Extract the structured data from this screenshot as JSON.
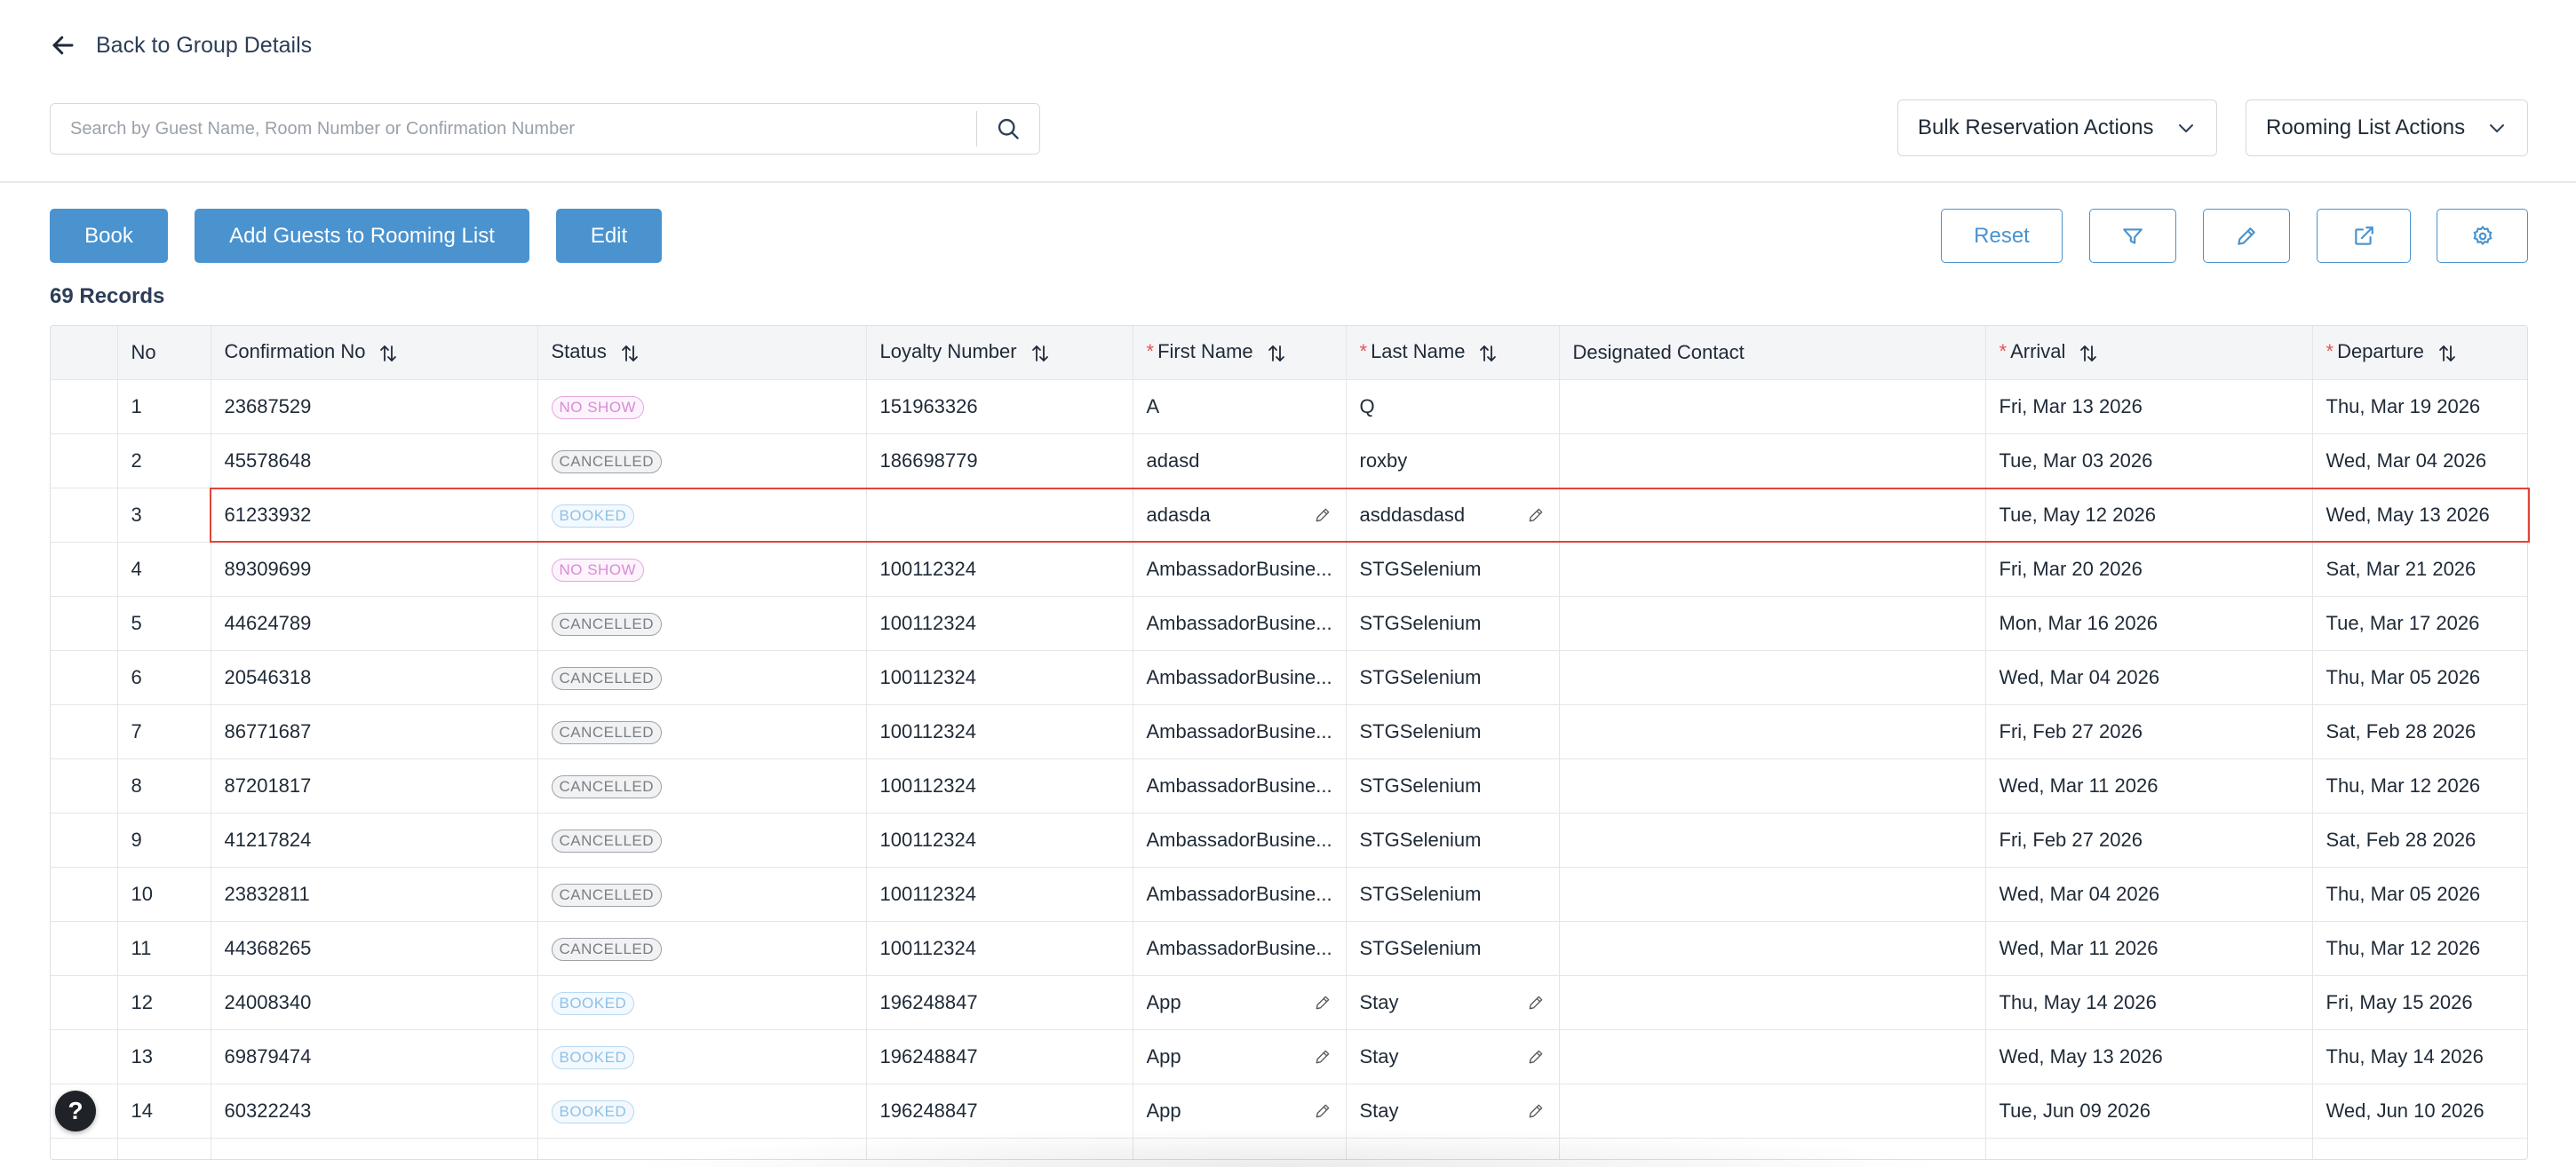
{
  "nav": {
    "back_label": "Back to Group Details"
  },
  "search": {
    "placeholder": "Search by Guest Name, Room Number or Confirmation Number",
    "value": ""
  },
  "dropdowns": {
    "bulk_label": "Bulk Reservation Actions",
    "rooming_label": "Rooming List Actions"
  },
  "toolbar": {
    "book_label": "Book",
    "add_guests_label": "Add Guests to Rooming List",
    "edit_label": "Edit",
    "reset_label": "Reset"
  },
  "records_label": "69 Records",
  "table": {
    "headers": {
      "no": "No",
      "confirmation": "Confirmation No",
      "status": "Status",
      "loyalty": "Loyalty Number",
      "first_name": "First Name",
      "last_name": "Last Name",
      "designated": "Designated Contact",
      "arrival": "Arrival",
      "departure": "Departure"
    },
    "required_mark": "*",
    "rows": [
      {
        "no": "1",
        "conf": "23687529",
        "status": "NO SHOW",
        "loyalty": "151963326",
        "first": "A",
        "last": "Q",
        "contact": "",
        "arrival": "Fri, Mar 13 2026",
        "departure": "Thu, Mar 19 2026"
      },
      {
        "no": "2",
        "conf": "45578648",
        "status": "CANCELLED",
        "loyalty": "186698779",
        "first": "adasd",
        "last": "roxby",
        "contact": "",
        "arrival": "Tue, Mar 03 2026",
        "departure": "Wed, Mar 04 2026"
      },
      {
        "no": "3",
        "conf": "61233932",
        "status": "BOOKED",
        "loyalty": "",
        "first": "adasda",
        "last": "asddasdasd",
        "contact": "",
        "arrival": "Tue, May 12 2026",
        "departure": "Wed, May 13 2026"
      },
      {
        "no": "4",
        "conf": "89309699",
        "status": "NO SHOW",
        "loyalty": "100112324",
        "first": "AmbassadorBusine...",
        "last": "STGSelenium",
        "contact": "",
        "arrival": "Fri, Mar 20 2026",
        "departure": "Sat, Mar 21 2026"
      },
      {
        "no": "5",
        "conf": "44624789",
        "status": "CANCELLED",
        "loyalty": "100112324",
        "first": "AmbassadorBusine...",
        "last": "STGSelenium",
        "contact": "",
        "arrival": "Mon, Mar 16 2026",
        "departure": "Tue, Mar 17 2026"
      },
      {
        "no": "6",
        "conf": "20546318",
        "status": "CANCELLED",
        "loyalty": "100112324",
        "first": "AmbassadorBusine...",
        "last": "STGSelenium",
        "contact": "",
        "arrival": "Wed, Mar 04 2026",
        "departure": "Thu, Mar 05 2026"
      },
      {
        "no": "7",
        "conf": "86771687",
        "status": "CANCELLED",
        "loyalty": "100112324",
        "first": "AmbassadorBusine...",
        "last": "STGSelenium",
        "contact": "",
        "arrival": "Fri, Feb 27 2026",
        "departure": "Sat, Feb 28 2026"
      },
      {
        "no": "8",
        "conf": "87201817",
        "status": "CANCELLED",
        "loyalty": "100112324",
        "first": "AmbassadorBusine...",
        "last": "STGSelenium",
        "contact": "",
        "arrival": "Wed, Mar 11 2026",
        "departure": "Thu, Mar 12 2026"
      },
      {
        "no": "9",
        "conf": "41217824",
        "status": "CANCELLED",
        "loyalty": "100112324",
        "first": "AmbassadorBusine...",
        "last": "STGSelenium",
        "contact": "",
        "arrival": "Fri, Feb 27 2026",
        "departure": "Sat, Feb 28 2026"
      },
      {
        "no": "10",
        "conf": "23832811",
        "status": "CANCELLED",
        "loyalty": "100112324",
        "first": "AmbassadorBusine...",
        "last": "STGSelenium",
        "contact": "",
        "arrival": "Wed, Mar 04 2026",
        "departure": "Thu, Mar 05 2026"
      },
      {
        "no": "11",
        "conf": "44368265",
        "status": "CANCELLED",
        "loyalty": "100112324",
        "first": "AmbassadorBusine...",
        "last": "STGSelenium",
        "contact": "",
        "arrival": "Wed, Mar 11 2026",
        "departure": "Thu, Mar 12 2026"
      },
      {
        "no": "12",
        "conf": "24008340",
        "status": "BOOKED",
        "loyalty": "196248847",
        "first": "App",
        "last": "Stay",
        "contact": "",
        "arrival": "Thu, May 14 2026",
        "departure": "Fri, May 15 2026"
      },
      {
        "no": "13",
        "conf": "69879474",
        "status": "BOOKED",
        "loyalty": "196248847",
        "first": "App",
        "last": "Stay",
        "contact": "",
        "arrival": "Wed, May 13 2026",
        "departure": "Thu, May 14 2026"
      },
      {
        "no": "14",
        "conf": "60322243",
        "status": "BOOKED",
        "loyalty": "196248847",
        "first": "App",
        "last": "Stay",
        "contact": "",
        "arrival": "Tue, Jun 09 2026",
        "departure": "Wed, Jun 10 2026"
      }
    ]
  },
  "help": {
    "label": "?"
  },
  "colors": {
    "primary": "#4a93cf",
    "highlight": "#e0443a",
    "required": "#e15656"
  },
  "icons": {
    "back": "arrow-left-icon",
    "search": "search-icon",
    "chevron": "chevron-down-icon",
    "filter": "filter-icon",
    "pencil": "pencil-icon",
    "export": "external-link-icon",
    "gear": "gear-icon",
    "sort": "sort-icon"
  }
}
